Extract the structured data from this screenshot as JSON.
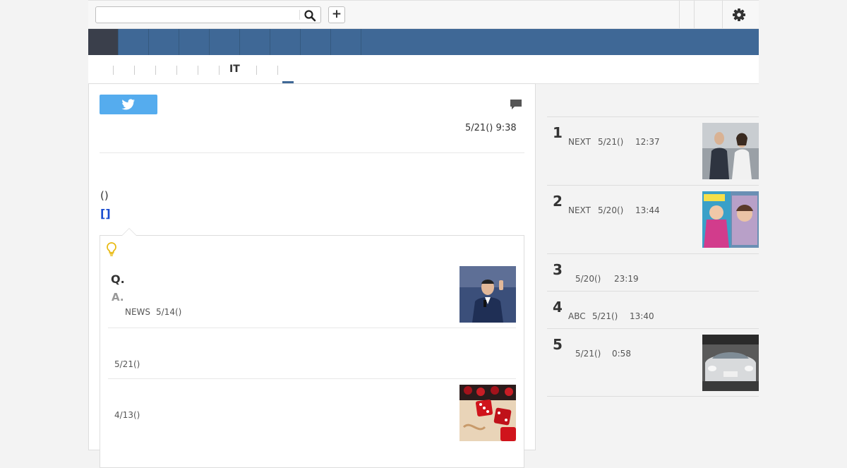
{
  "header": {
    "search": {
      "value": "",
      "placeholder": ""
    },
    "plus_label": "+"
  },
  "subnav": {
    "it_label": "IT"
  },
  "article": {
    "date": "5/21() 9:38",
    "paren": "()",
    "bracket_link": "[]",
    "qa": {
      "q": "Q.",
      "a": "A.",
      "source": "NEWS",
      "date": "5/14()"
    },
    "related": [
      {
        "date": "5/21()"
      },
      {
        "date": "4/13()"
      }
    ]
  },
  "ranking": [
    {
      "num": "1",
      "source": "NEXT",
      "date": "5/21()",
      "time": "12:37"
    },
    {
      "num": "2",
      "source": "NEXT",
      "date": "5/20()",
      "time": "13:44"
    },
    {
      "num": "3",
      "source": "",
      "date": "5/20()",
      "time": "23:19"
    },
    {
      "num": "4",
      "source": "ABC",
      "date": "5/21()",
      "time": "13:40"
    },
    {
      "num": "5",
      "source": "",
      "date": "5/21()",
      "time": "0:58"
    }
  ],
  "colors": {
    "nav_bg": "#3f6896",
    "nav_active": "#3a3f4b",
    "twitter": "#55acee",
    "link": "#1a4ccf",
    "bulb": "#e8b90e"
  },
  "icons": [
    "search-icon",
    "plus-icon",
    "gear-icon",
    "twitter-icon",
    "comment-icon",
    "lightbulb-icon"
  ]
}
